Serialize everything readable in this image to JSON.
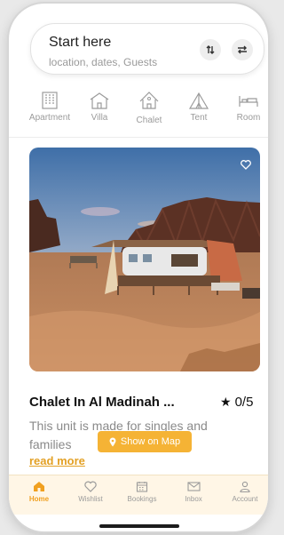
{
  "search": {
    "title": "Start here",
    "subtitle": "location, dates, Guests",
    "sort_icon": "sort-arrows-icon",
    "filter_icon": "swap-arrows-icon"
  },
  "categories": [
    {
      "label": "Apartment",
      "icon": "apartment-icon"
    },
    {
      "label": "Villa",
      "icon": "villa-icon"
    },
    {
      "label": "Chalet",
      "icon": "chalet-icon"
    },
    {
      "label": "Tent",
      "icon": "tent-icon"
    },
    {
      "label": "Room",
      "icon": "bed-icon"
    }
  ],
  "listing": {
    "title": "Chalet In Al Madinah ...",
    "rating": "0/5",
    "description": "This unit is made for singles and families",
    "read_more": "read more",
    "map_button": "Show on Map"
  },
  "tabs": [
    {
      "label": "Home",
      "icon": "home-icon",
      "active": true
    },
    {
      "label": "Wishlist",
      "icon": "heart-icon",
      "active": false
    },
    {
      "label": "Bookings",
      "icon": "calendar-icon",
      "active": false
    },
    {
      "label": "Inbox",
      "icon": "mail-icon",
      "active": false
    },
    {
      "label": "Account",
      "icon": "user-icon",
      "active": false
    }
  ],
  "colors": {
    "accent": "#f5b335",
    "accent_text": "#f0a020",
    "tabbar_bg": "#fff6e6"
  }
}
